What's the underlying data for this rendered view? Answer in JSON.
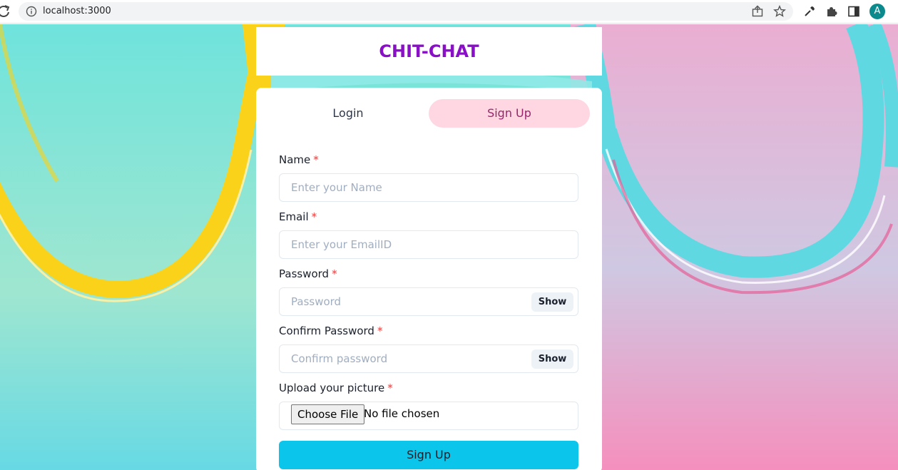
{
  "browser": {
    "url": "localhost:3000",
    "avatar_letter": "A",
    "icons": [
      "reload-icon",
      "info-icon",
      "share-icon",
      "star-icon",
      "eyedropper-icon",
      "extensions-icon",
      "side-panel-icon"
    ]
  },
  "header": {
    "title": "CHIT-CHAT",
    "title_color": "#8a10c8"
  },
  "tabs": {
    "login": "Login",
    "signup": "Sign Up",
    "active": "signup",
    "active_bg": "#fed7e2",
    "active_color": "#97266d"
  },
  "form": {
    "required_marker": "*",
    "name_label": "Name",
    "name_placeholder": "Enter your Name",
    "email_label": "Email",
    "email_placeholder": "Enter your EmailID",
    "password_label": "Password",
    "password_placeholder": "Password",
    "password_show": "Show",
    "confirm_label": "Confirm Password",
    "confirm_placeholder": "Confirm password",
    "confirm_show": "Show",
    "picture_label": "Upload your picture",
    "file_button": "Choose File",
    "file_status": "No file chosen",
    "submit_label": "Sign Up",
    "submit_color": "#0bc5ea"
  }
}
